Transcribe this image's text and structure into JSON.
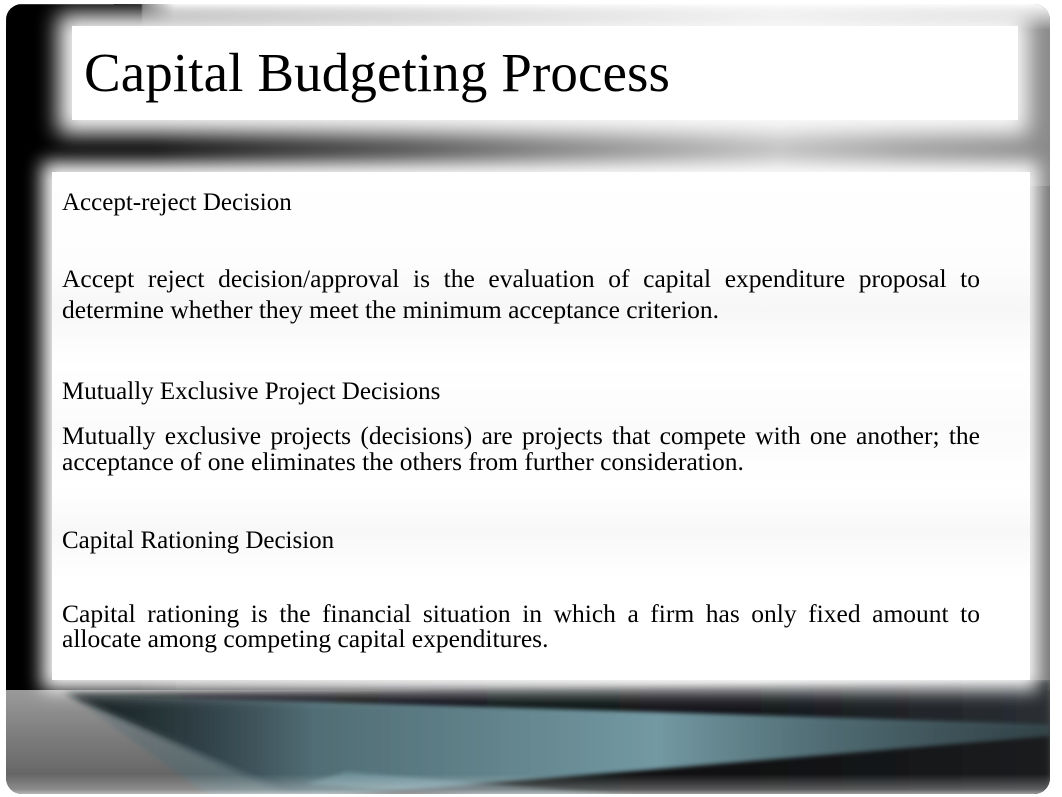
{
  "slide": {
    "title": "Capital Budgeting Process",
    "theme": {
      "frame_dark": "#000000",
      "frame_mid": "#7d7d7d",
      "frame_light": "#c0c0c0",
      "panel_background": "#ffffff",
      "text_color": "#000000",
      "accent_teal": "#5d7e86"
    },
    "body": {
      "sections": [
        {
          "heading": "Accept-reject Decision",
          "paragraph": "Accept reject decision/approval is the evaluation of capital expenditure proposal to determine whether they meet the minimum acceptance criterion."
        },
        {
          "heading": "Mutually Exclusive Project Decisions",
          "paragraph": "Mutually exclusive projects (decisions) are projects that compete with one another; the acceptance of one eliminates the others from further consideration."
        },
        {
          "heading": "Capital Rationing Decision",
          "paragraph": "Capital rationing is the financial situation in which a firm has only fixed amount to allocate among competing capital expenditures."
        }
      ]
    }
  }
}
